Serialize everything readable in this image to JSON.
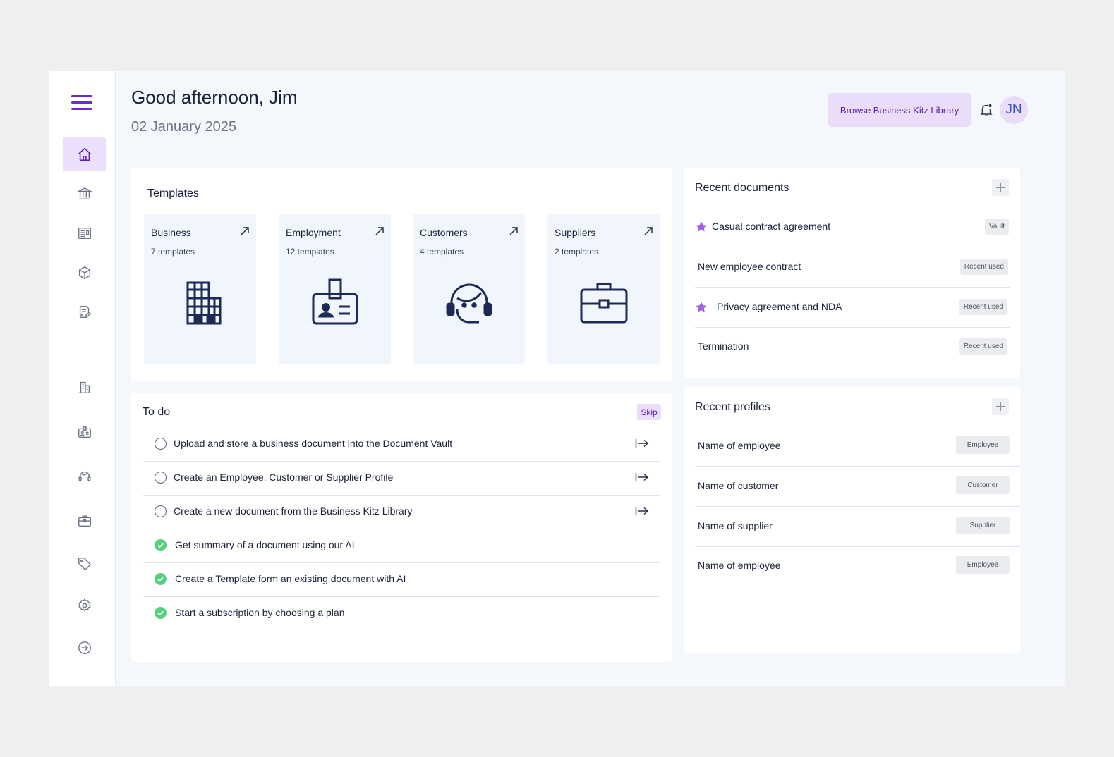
{
  "header": {
    "greeting": "Good afternoon, Jim",
    "date": "02 January 2025",
    "browse_label": "Browse Business Kitz Library",
    "avatar_initials": "JN"
  },
  "sidebar": {
    "items": [
      {
        "name": "home-icon",
        "active": true
      },
      {
        "name": "bank-icon"
      },
      {
        "name": "document-list-icon"
      },
      {
        "name": "package-icon"
      },
      {
        "name": "signature-icon"
      },
      {
        "name": "building-icon"
      },
      {
        "name": "id-badge-icon"
      },
      {
        "name": "headset-icon"
      },
      {
        "name": "briefcase-icon"
      },
      {
        "name": "tag-icon"
      },
      {
        "name": "gear-icon"
      },
      {
        "name": "logout-icon"
      }
    ]
  },
  "templates": {
    "title": "Templates",
    "items": [
      {
        "name": "Business",
        "count": "7 templates",
        "icon": "building-icon"
      },
      {
        "name": "Employment",
        "count": "12 templates",
        "icon": "id-badge-icon"
      },
      {
        "name": "Customers",
        "count": "4 templates",
        "icon": "headset-icon"
      },
      {
        "name": "Suppliers",
        "count": "2 templates",
        "icon": "briefcase-icon"
      }
    ]
  },
  "todo": {
    "title": "To do",
    "skip_label": "Skip",
    "items": [
      {
        "text": "Upload and store a business document into the Document Vault",
        "done": false
      },
      {
        "text": "Create an Employee, Customer or Supplier Profile",
        "done": false
      },
      {
        "text": "Create a new document from the Business Kitz Library",
        "done": false
      },
      {
        "text": "Get summary of a document using our AI",
        "done": true
      },
      {
        "text": "Create a Template form an existing document with AI",
        "done": true
      },
      {
        "text": "Start a subscription by choosing a plan",
        "done": true
      }
    ]
  },
  "recent_documents": {
    "title": "Recent documents",
    "items": [
      {
        "name": "Casual contract agreement",
        "tag": "Vault",
        "starred": true
      },
      {
        "name": "New employee contract",
        "tag": "Recent used",
        "starred": false
      },
      {
        "name": "Privacy agreement and NDA",
        "tag": "Recent used",
        "starred": true
      },
      {
        "name": "Termination",
        "tag": "Recent used",
        "starred": false
      }
    ]
  },
  "recent_profiles": {
    "title": "Recent profiles",
    "items": [
      {
        "name": "Name of employee",
        "tag": "Employee"
      },
      {
        "name": "Name of customer",
        "tag": "Customer"
      },
      {
        "name": "Name of supplier",
        "tag": "Supplier"
      },
      {
        "name": "Name of employee",
        "tag": "Employee"
      }
    ]
  },
  "colors": {
    "accent": "#6a2bd3",
    "accent_bg": "#ebdcfa",
    "navy": "#1c2a55",
    "success": "#55d17b",
    "star": "#a061e6"
  }
}
